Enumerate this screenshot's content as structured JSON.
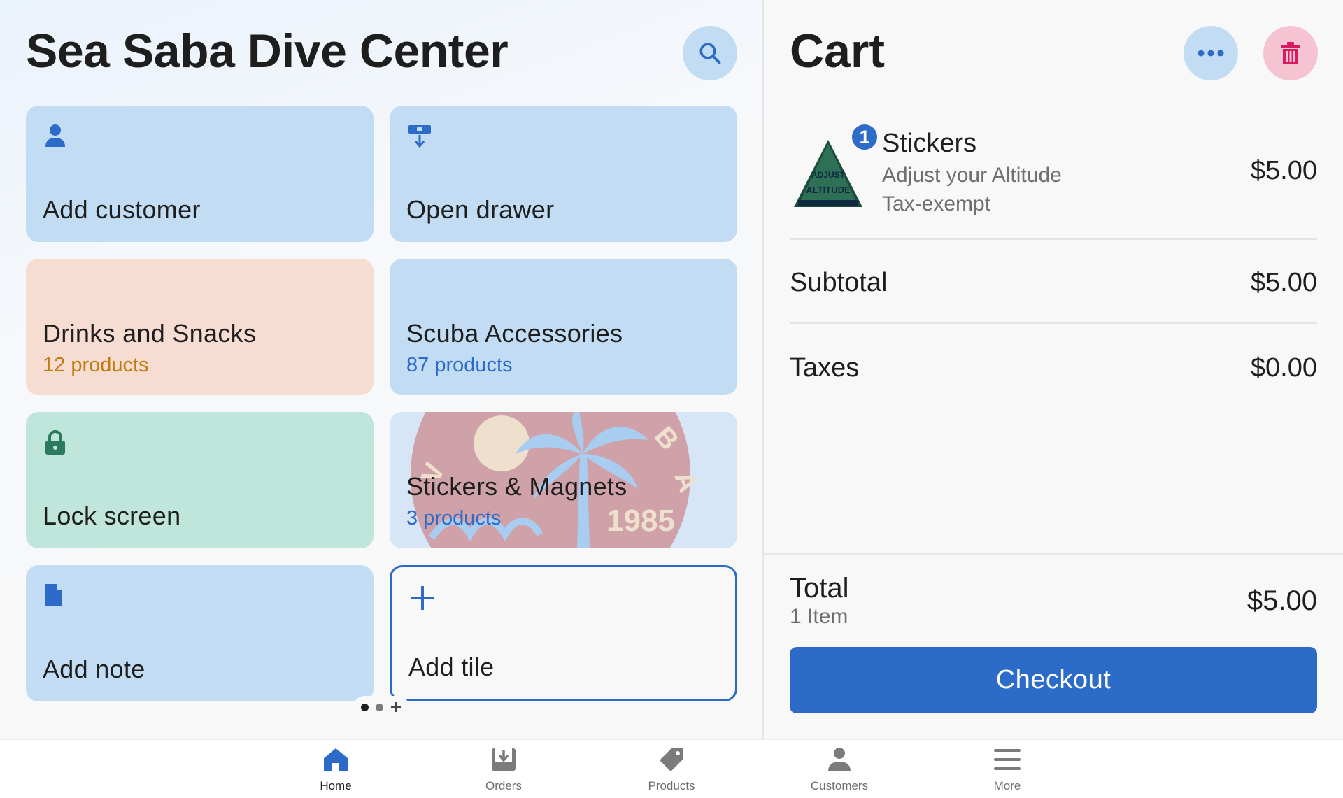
{
  "store": {
    "title": "Sea Saba Dive Center"
  },
  "tiles": {
    "add_customer": {
      "label": "Add customer",
      "icon": "person-icon"
    },
    "open_drawer": {
      "label": "Open drawer",
      "icon": "cash-drawer-icon"
    },
    "drinks": {
      "label": "Drinks and Snacks",
      "sub": "12 products"
    },
    "scuba": {
      "label": "Scuba Accessories",
      "sub": "87 products"
    },
    "lock": {
      "label": "Lock screen",
      "icon": "lock-icon"
    },
    "stickers": {
      "label": "Stickers & Magnets",
      "sub": "3 products",
      "logo_text": "DIVE SABA",
      "logo_year": "1985"
    },
    "add_note": {
      "label": "Add note",
      "icon": "document-icon"
    },
    "add_tile": {
      "label": "Add tile",
      "icon": "plus-icon"
    }
  },
  "pager": {
    "pages": 2,
    "current": 1
  },
  "cart": {
    "title": "Cart",
    "item": {
      "name": "Stickers",
      "description": "Adjust your Altitude",
      "tax_note": "Tax-exempt",
      "price": "$5.00",
      "quantity": "1",
      "thumb_text": "ADJUST ALTITUDE"
    },
    "subtotal_label": "Subtotal",
    "subtotal_value": "$5.00",
    "taxes_label": "Taxes",
    "taxes_value": "$0.00",
    "total_label": "Total",
    "total_count": "1 Item",
    "total_value": "$5.00",
    "checkout_label": "Checkout"
  },
  "nav": {
    "items": [
      {
        "label": "Home",
        "icon": "home-icon",
        "active": true
      },
      {
        "label": "Orders",
        "icon": "orders-icon"
      },
      {
        "label": "Products",
        "icon": "tag-icon"
      },
      {
        "label": "Customers",
        "icon": "person-icon"
      },
      {
        "label": "More",
        "icon": "menu-icon"
      }
    ]
  },
  "colors": {
    "accent": "#2d6bc9",
    "tile_blue": "#c2dcf3",
    "tile_peach": "#f6dcd1",
    "tile_mint": "#c0e6dc",
    "drinks_sub": "#c07a10",
    "lock_icon": "#2b7b5e",
    "trash_icon": "#d81b60"
  }
}
